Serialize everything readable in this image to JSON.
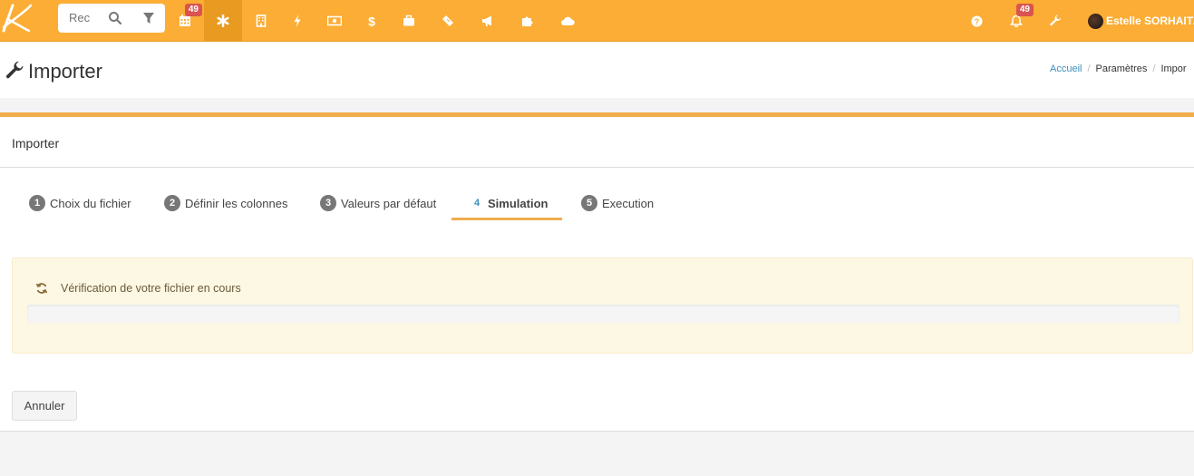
{
  "navbar": {
    "search": {
      "placeholder": "Rec"
    },
    "items": [
      {
        "icon": "calendar-icon",
        "badge": "49"
      },
      {
        "icon": "asterisk-icon"
      },
      {
        "icon": "building-icon"
      },
      {
        "icon": "bolt-icon"
      },
      {
        "icon": "money-icon"
      },
      {
        "icon": "dollar-icon"
      },
      {
        "icon": "briefcase-icon"
      },
      {
        "icon": "ticket-icon"
      },
      {
        "icon": "bullhorn-icon"
      },
      {
        "icon": "puzzle-icon"
      },
      {
        "icon": "cloud-icon"
      }
    ],
    "notifications_badge": "49",
    "user_name": "Estelle SORHAITZ"
  },
  "page": {
    "title": "Importer",
    "breadcrumb": [
      "Accueil",
      "Paramètres",
      "Impor"
    ]
  },
  "panel": {
    "title": "Importer",
    "steps": [
      {
        "num": "1",
        "label": "Choix du fichier"
      },
      {
        "num": "2",
        "label": "Définir les colonnes"
      },
      {
        "num": "3",
        "label": "Valeurs par défaut"
      },
      {
        "num": "4",
        "label": "Simulation"
      },
      {
        "num": "5",
        "label": "Execution"
      }
    ],
    "active_step": "4",
    "status_message": "Vérification de votre fichier en cours",
    "cancel_label": "Annuler"
  },
  "colors": {
    "navbar": "#fbad35",
    "navbar_active": "#e99a20",
    "accent": "#f0ad4e",
    "badge": "#d9534f",
    "link": "#3c8dbc",
    "alert_bg": "#fcf8e3"
  }
}
